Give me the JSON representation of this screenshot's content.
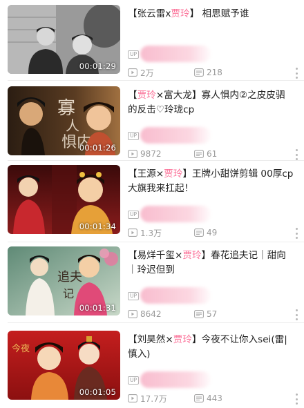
{
  "videos": [
    {
      "title_prefix": "【张云雷x",
      "title_highlight": "贾玲",
      "title_rest": "】 相思赋予谁",
      "duration": "00:01:29",
      "up_badge": "UP",
      "uploader": "",
      "views": "2万",
      "danmaku": "218",
      "thumb_colors": [
        "#6d6d6d",
        "#2a2a2a",
        "#c9c9c9"
      ]
    },
    {
      "title_prefix": "【",
      "title_highlight": "贾玲",
      "title_rest": "×富大龙】寡人惧内②之皮皮驷的反击♡玲珑cp",
      "duration": "00:01:26",
      "up_badge": "UP",
      "uploader": "",
      "views": "9872",
      "danmaku": "61",
      "thumb_colors": [
        "#3b2a1c",
        "#8a5a30",
        "#e0b880"
      ]
    },
    {
      "title_prefix": "【王源×",
      "title_highlight": "贾玲",
      "title_rest": "】王牌小甜饼剪辑 00厚cp大旗我来扛起！",
      "duration": "00:01:34",
      "up_badge": "UP",
      "uploader": "",
      "views": "1.3万",
      "danmaku": "49",
      "thumb_colors": [
        "#7a1414",
        "#c23030",
        "#e8a060"
      ]
    },
    {
      "title_prefix": "【易烊千玺×",
      "title_highlight": "贾玲",
      "title_rest": "】春花追夫记｜甜向｜玲迟但到",
      "duration": "00:01:31",
      "up_badge": "UP",
      "uploader": "",
      "views": "8642",
      "danmaku": "57",
      "thumb_colors": [
        "#7fa890",
        "#e04a78",
        "#f2e6d8"
      ]
    },
    {
      "title_prefix": "【刘昊然×",
      "title_highlight": "贾玲",
      "title_rest": "】今夜不让你入sei(雷|慎入)",
      "duration": "00:01:05",
      "up_badge": "UP",
      "uploader": "",
      "views": "17.7万",
      "danmaku": "443",
      "thumb_colors": [
        "#b01818",
        "#e03c3c",
        "#f0c090"
      ]
    }
  ],
  "icons": {
    "play": "play-count-icon",
    "danmaku": "danmaku-icon",
    "more": "more-options-icon"
  },
  "colors": {
    "highlight": "#fb7299",
    "meta": "#999999"
  }
}
